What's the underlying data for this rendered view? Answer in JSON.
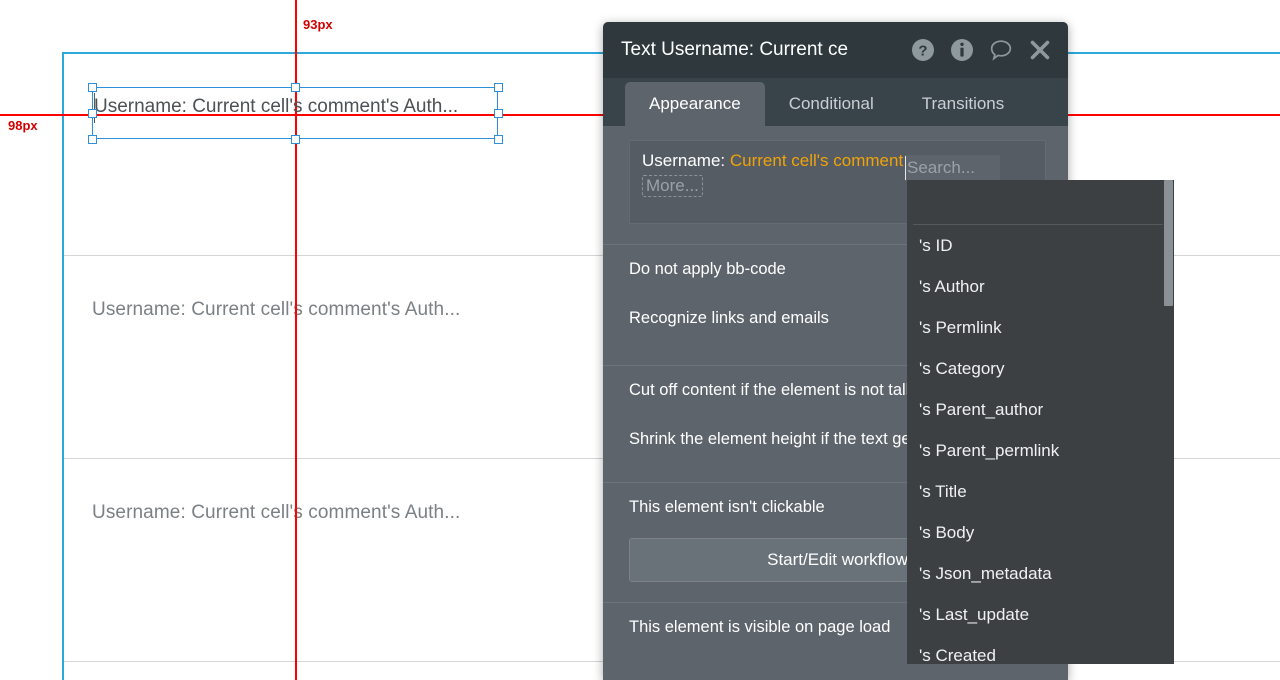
{
  "canvas": {
    "cells": [
      {
        "text": "Username: Current cell's comment's Auth..."
      },
      {
        "text": "Username: Current cell's comment's Auth..."
      },
      {
        "text": "Username: Current cell's comment's Auth..."
      }
    ],
    "selected_element_text": "Username: Current cell's comment's Auth...",
    "guides": {
      "horizontal_label": "98px",
      "vertical_label": "93px",
      "color": "#ff0000"
    },
    "selection_color": "#2f8fd8",
    "container_border_color": "#2ca8db"
  },
  "dialog": {
    "title": "Text Username: Current ce",
    "header_icons": [
      {
        "name": "help-icon",
        "glyph": "?"
      },
      {
        "name": "info-icon",
        "glyph": "i"
      },
      {
        "name": "comment-icon",
        "glyph": "speech-bubble"
      },
      {
        "name": "close-icon",
        "glyph": "x"
      }
    ],
    "tabs": [
      {
        "label": "Appearance",
        "active": true
      },
      {
        "label": "Conditional",
        "active": false
      },
      {
        "label": "Transitions",
        "active": false
      }
    ],
    "editor": {
      "static_text": "Username: ",
      "dynamic_text": "Current cell's comment",
      "dynamic_color": "#f0a30a",
      "more_chip": "More..."
    },
    "options": [
      {
        "label": "Do not apply bb-code",
        "checked": false
      },
      {
        "label": "Recognize links and emails",
        "checked": false
      },
      {
        "label": "Cut off content if the element is not tall enough",
        "checked": false
      },
      {
        "label": "Shrink the element height if the text gets shorter",
        "checked": false
      },
      {
        "label": "This element isn't clickable",
        "checked": false
      },
      {
        "label": "This element is visible on page load",
        "checked": false
      }
    ],
    "workflow_button": "Start/Edit workflow"
  },
  "search": {
    "placeholder": "Search...",
    "value": ""
  },
  "dropdown": {
    "items": [
      "'s ID",
      "'s Author",
      "'s Permlink",
      "'s Category",
      "'s Parent_author",
      "'s Parent_permlink",
      "'s Title",
      "'s Body",
      "'s Json_metadata",
      "'s Last_update",
      "'s Created"
    ]
  }
}
